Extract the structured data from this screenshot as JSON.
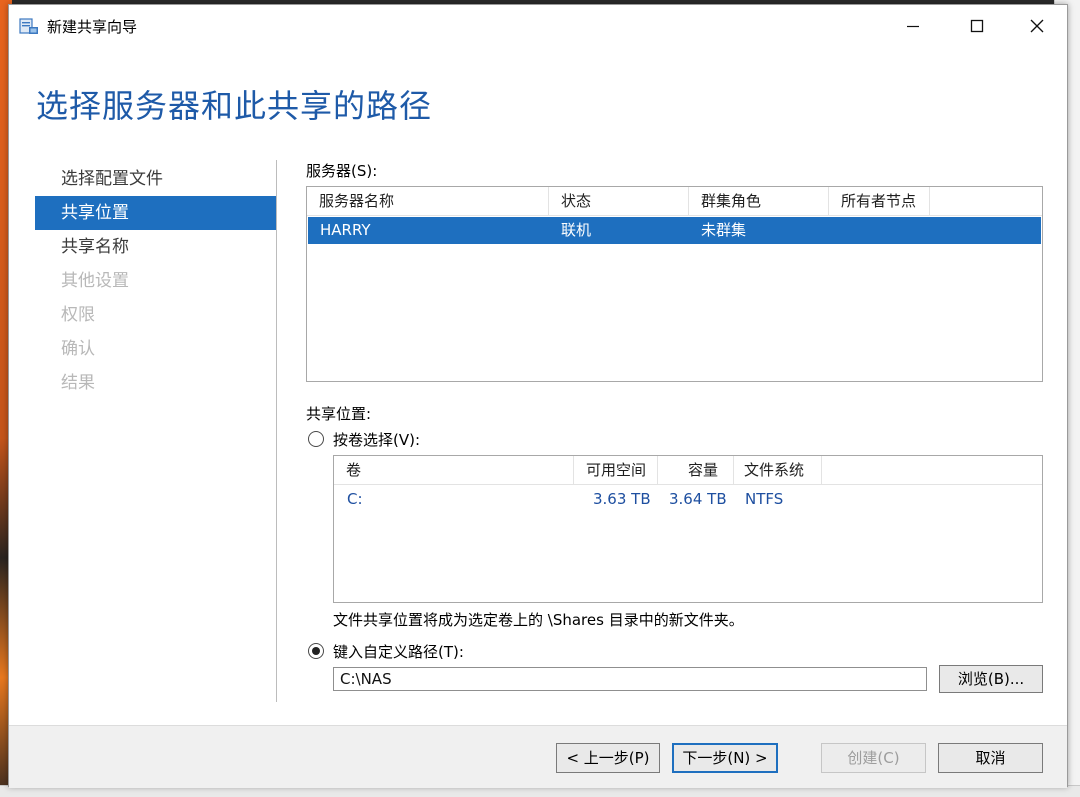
{
  "window": {
    "title": "新建共享向导",
    "page_title": "选择服务器和此共享的路径"
  },
  "nav": {
    "items": [
      {
        "label": "选择配置文件",
        "state": "normal"
      },
      {
        "label": "共享位置",
        "state": "active"
      },
      {
        "label": "共享名称",
        "state": "normal"
      },
      {
        "label": "其他设置",
        "state": "disabled"
      },
      {
        "label": "权限",
        "state": "disabled"
      },
      {
        "label": "确认",
        "state": "disabled"
      },
      {
        "label": "结果",
        "state": "disabled"
      }
    ]
  },
  "servers": {
    "label": "服务器(S):",
    "columns": [
      "服务器名称",
      "状态",
      "群集角色",
      "所有者节点"
    ],
    "rows": [
      {
        "name": "HARRY",
        "status": "联机",
        "cluster_role": "未群集",
        "owner_node": ""
      }
    ]
  },
  "share_location": {
    "label": "共享位置:",
    "by_volume_label": "按卷选择(V):",
    "volume_columns": [
      "卷",
      "可用空间",
      "容量",
      "文件系统"
    ],
    "volumes": [
      {
        "volume": "C:",
        "free": "3.63 TB",
        "capacity": "3.64 TB",
        "fs": "NTFS"
      }
    ],
    "note": "文件共享位置将成为选定卷上的 \\Shares 目录中的新文件夹。",
    "custom_path_label": "键入自定义路径(T):",
    "custom_path_value": "C:\\NAS",
    "browse_label": "浏览(B)..."
  },
  "buttons": {
    "prev": "< 上一步(P)",
    "next": "下一步(N) >",
    "create": "创建(C)",
    "cancel": "取消"
  },
  "colors": {
    "accent": "#1e6fbf",
    "title_blue": "#1e5aa8"
  }
}
